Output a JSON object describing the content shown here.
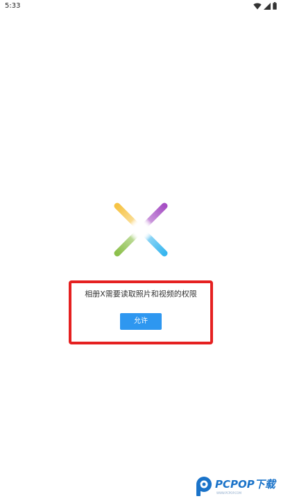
{
  "status_bar": {
    "time": "5:33",
    "icons": [
      "wifi-icon",
      "signal-icon",
      "battery-icon"
    ]
  },
  "app": {
    "logo_icon": "album-x-logo-icon",
    "logo_colors": [
      "#f6c344",
      "#a64fc4",
      "#8cc04b",
      "#38b6ef"
    ]
  },
  "permission": {
    "message": "相册X需要读取照片和视频的权限",
    "allow_label": "允许",
    "button_color": "#2e97f0",
    "highlight_color": "#e52020"
  },
  "watermark": {
    "brand": "PCPOP下载",
    "tagline": "WWW.PCPOP.COM",
    "color": "#1a73c9"
  }
}
